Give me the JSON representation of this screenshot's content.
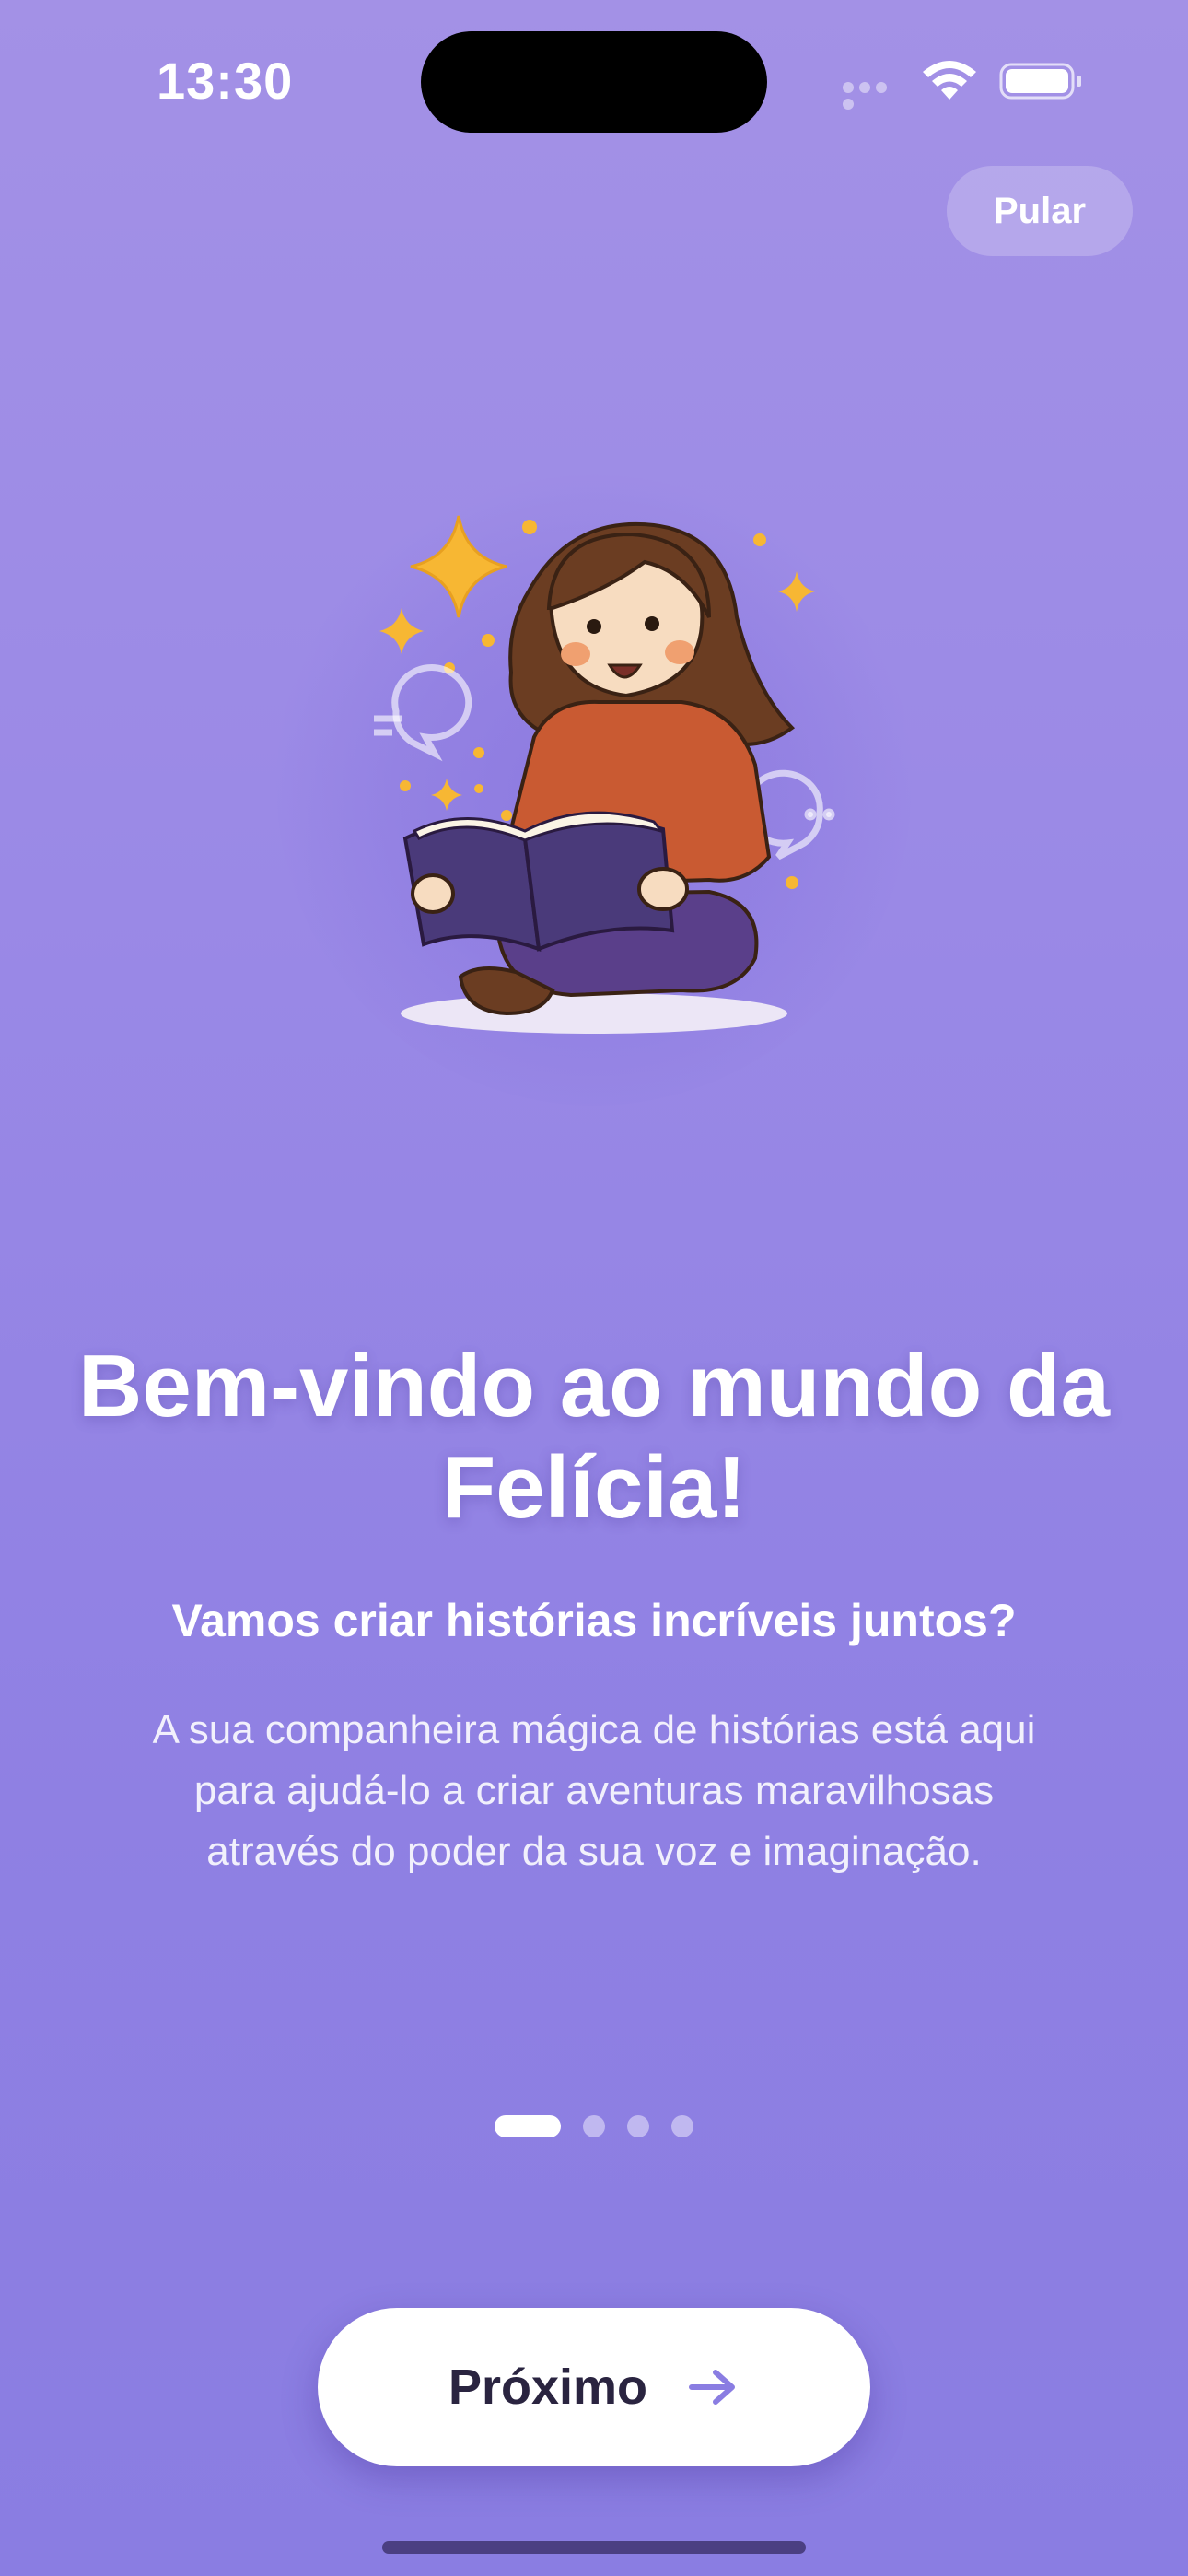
{
  "status_bar": {
    "time": "13:30"
  },
  "header": {
    "skip_label": "Pular"
  },
  "illustration": {
    "subject": "girl-reading-book"
  },
  "content": {
    "title": "Bem-vindo ao mundo da Felícia!",
    "subtitle": "Vamos criar histórias incríveis juntos?",
    "description": "A sua companheira mágica de histórias está aqui para ajudá-lo a criar aventuras maravilhosas através do poder da sua voz e imaginação."
  },
  "pager": {
    "total": 4,
    "current": 1
  },
  "footer": {
    "next_label": "Próximo"
  },
  "colors": {
    "background_top": "#a391e6",
    "background_bottom": "#8a7de2",
    "accent": "#8a7de2",
    "button_text": "#2a2440",
    "star_yellow": "#f7b733",
    "hoodie": "#c95a32",
    "hair": "#6b3d22",
    "book": "#4a3a7a"
  }
}
